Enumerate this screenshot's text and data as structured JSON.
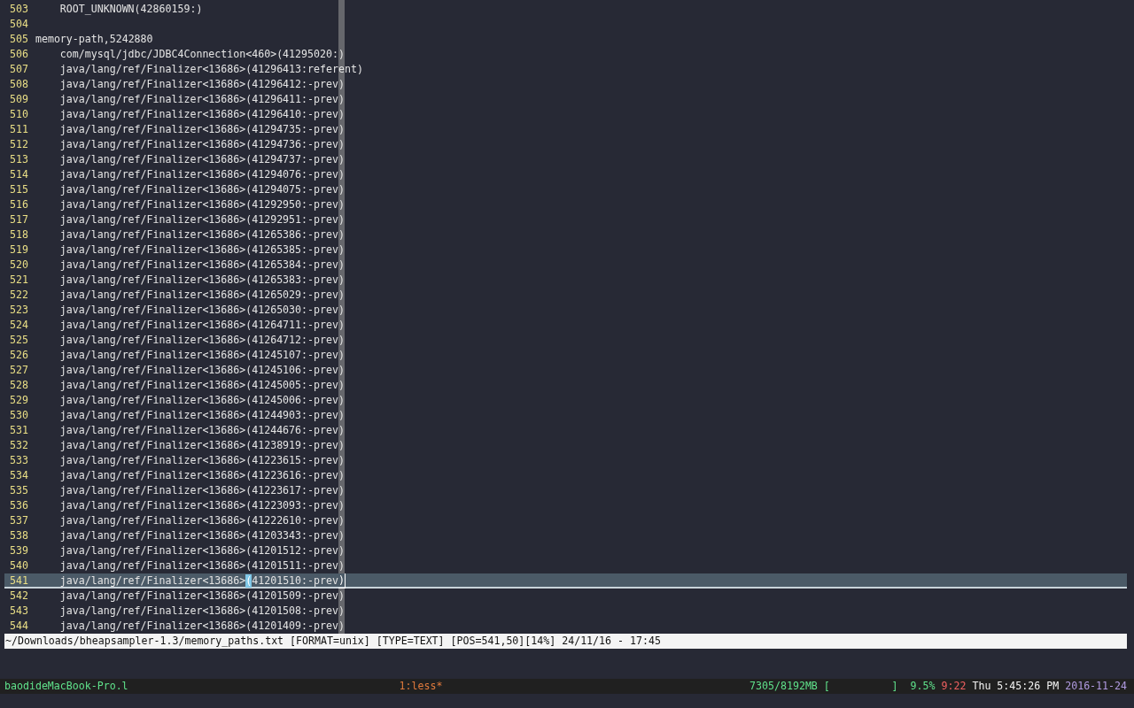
{
  "editor": {
    "lines": [
      {
        "number": "503",
        "kind": "entry",
        "text": "ROOT_UNKNOWN(42860159:)"
      },
      {
        "number": "504",
        "kind": "blank"
      },
      {
        "number": "505",
        "kind": "header",
        "text": "memory-path,5242880"
      },
      {
        "number": "506",
        "kind": "entry",
        "text": "com/mysql/jdbc/JDBC4Connection<460>(41295020:)"
      },
      {
        "number": "507",
        "kind": "entry",
        "text": "java/lang/ref/Finalizer<13686>(41296413:referent)"
      },
      {
        "number": "508",
        "kind": "entry",
        "text": "java/lang/ref/Finalizer<13686>(41296412:-prev)"
      },
      {
        "number": "509",
        "kind": "entry",
        "text": "java/lang/ref/Finalizer<13686>(41296411:-prev)"
      },
      {
        "number": "510",
        "kind": "entry",
        "text": "java/lang/ref/Finalizer<13686>(41296410:-prev)"
      },
      {
        "number": "511",
        "kind": "entry",
        "text": "java/lang/ref/Finalizer<13686>(41294735:-prev)"
      },
      {
        "number": "512",
        "kind": "entry",
        "text": "java/lang/ref/Finalizer<13686>(41294736:-prev)"
      },
      {
        "number": "513",
        "kind": "entry",
        "text": "java/lang/ref/Finalizer<13686>(41294737:-prev)"
      },
      {
        "number": "514",
        "kind": "entry",
        "text": "java/lang/ref/Finalizer<13686>(41294076:-prev)"
      },
      {
        "number": "515",
        "kind": "entry",
        "text": "java/lang/ref/Finalizer<13686>(41294075:-prev)"
      },
      {
        "number": "516",
        "kind": "entry",
        "text": "java/lang/ref/Finalizer<13686>(41292950:-prev)"
      },
      {
        "number": "517",
        "kind": "entry",
        "text": "java/lang/ref/Finalizer<13686>(41292951:-prev)"
      },
      {
        "number": "518",
        "kind": "entry",
        "text": "java/lang/ref/Finalizer<13686>(41265386:-prev)"
      },
      {
        "number": "519",
        "kind": "entry",
        "text": "java/lang/ref/Finalizer<13686>(41265385:-prev)"
      },
      {
        "number": "520",
        "kind": "entry",
        "text": "java/lang/ref/Finalizer<13686>(41265384:-prev)"
      },
      {
        "number": "521",
        "kind": "entry",
        "text": "java/lang/ref/Finalizer<13686>(41265383:-prev)"
      },
      {
        "number": "522",
        "kind": "entry",
        "text": "java/lang/ref/Finalizer<13686>(41265029:-prev)"
      },
      {
        "number": "523",
        "kind": "entry",
        "text": "java/lang/ref/Finalizer<13686>(41265030:-prev)"
      },
      {
        "number": "524",
        "kind": "entry",
        "text": "java/lang/ref/Finalizer<13686>(41264711:-prev)"
      },
      {
        "number": "525",
        "kind": "entry",
        "text": "java/lang/ref/Finalizer<13686>(41264712:-prev)"
      },
      {
        "number": "526",
        "kind": "entry",
        "text": "java/lang/ref/Finalizer<13686>(41245107:-prev)"
      },
      {
        "number": "527",
        "kind": "entry",
        "text": "java/lang/ref/Finalizer<13686>(41245106:-prev)"
      },
      {
        "number": "528",
        "kind": "entry",
        "text": "java/lang/ref/Finalizer<13686>(41245005:-prev)"
      },
      {
        "number": "529",
        "kind": "entry",
        "text": "java/lang/ref/Finalizer<13686>(41245006:-prev)"
      },
      {
        "number": "530",
        "kind": "entry",
        "text": "java/lang/ref/Finalizer<13686>(41244903:-prev)"
      },
      {
        "number": "531",
        "kind": "entry",
        "text": "java/lang/ref/Finalizer<13686>(41244676:-prev)"
      },
      {
        "number": "532",
        "kind": "entry",
        "text": "java/lang/ref/Finalizer<13686>(41238919:-prev)"
      },
      {
        "number": "533",
        "kind": "entry",
        "text": "java/lang/ref/Finalizer<13686>(41223615:-prev)"
      },
      {
        "number": "534",
        "kind": "entry",
        "text": "java/lang/ref/Finalizer<13686>(41223616:-prev)"
      },
      {
        "number": "535",
        "kind": "entry",
        "text": "java/lang/ref/Finalizer<13686>(41223617:-prev)"
      },
      {
        "number": "536",
        "kind": "entry",
        "text": "java/lang/ref/Finalizer<13686>(41223093:-prev)"
      },
      {
        "number": "537",
        "kind": "entry",
        "text": "java/lang/ref/Finalizer<13686>(41222610:-prev)"
      },
      {
        "number": "538",
        "kind": "entry",
        "text": "java/lang/ref/Finalizer<13686>(41203343:-prev)"
      },
      {
        "number": "539",
        "kind": "entry",
        "text": "java/lang/ref/Finalizer<13686>(41201512:-prev)"
      },
      {
        "number": "540",
        "kind": "entry",
        "text": "java/lang/ref/Finalizer<13686>(41201511:-prev)"
      },
      {
        "number": "541",
        "kind": "cursor",
        "before": "java/lang/ref/Finalizer<13686>",
        "cursor_char": "(",
        "after": "41201510:-prev",
        "match_char": ")"
      },
      {
        "number": "542",
        "kind": "entry",
        "text": "java/lang/ref/Finalizer<13686>(41201509:-prev)"
      },
      {
        "number": "543",
        "kind": "entry",
        "text": "java/lang/ref/Finalizer<13686>(41201508:-prev)"
      },
      {
        "number": "544",
        "kind": "entry",
        "text": "java/lang/ref/Finalizer<13686>(41201409:-prev)"
      }
    ],
    "status_line": "~/Downloads/bheapsampler-1.3/memory_paths.txt [FORMAT=unix] [TYPE=TEXT] [POS=541,50][14%] 24/11/16 - 17:45"
  },
  "tmux_bar": {
    "host": "baodideMacBook-Pro.l",
    "window": "1:less*",
    "memory": "7305/8192MB",
    "memory_bar": "[          ]",
    "cpu": "9.5%",
    "load": "9:22",
    "clock": "Thu 5:45:26 PM",
    "date": "2016-11-24"
  }
}
